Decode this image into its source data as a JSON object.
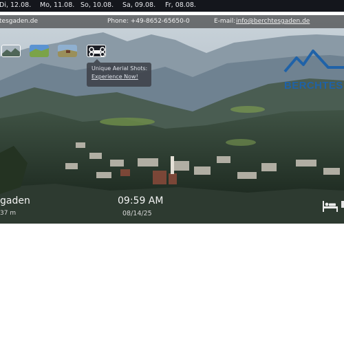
{
  "date_strip": {
    "dates": [
      "Di, 12.08.",
      "Mo, 11.08.",
      "So, 10.08.",
      "Sa, 09.08.",
      "Fr, 08.08."
    ]
  },
  "info_bar": {
    "website": "tesgaden.de",
    "phone": "Phone: +49-8652-65650-0",
    "email_label": "E-mail:",
    "email": "info@berchtesgaden.de"
  },
  "thumbnails": [
    {
      "name": "mountain-view",
      "active": true
    },
    {
      "name": "alpine-meadow",
      "active": false
    },
    {
      "name": "mountain-hut",
      "active": false
    },
    {
      "name": "drone-aerial",
      "active": false
    }
  ],
  "tooltip": {
    "line1": "Unique Aerial Shots:",
    "link": "Experience Now!"
  },
  "brand": {
    "text": "BERCHTES",
    "color": "#1f62a8"
  },
  "overlay": {
    "location": "gaden",
    "elevation": "37 m",
    "time": "09:59 AM",
    "date": "08/14/25"
  },
  "icons": {
    "bed": "bed-icon"
  }
}
